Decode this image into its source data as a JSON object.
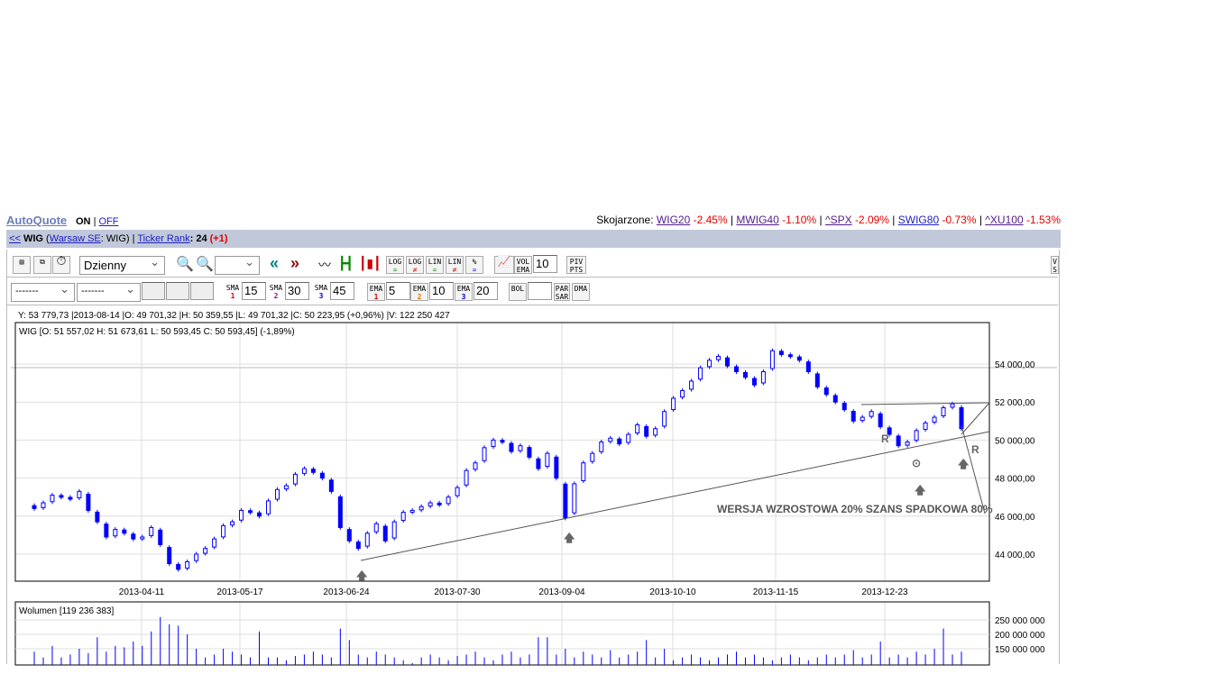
{
  "header": {
    "brand": "AutoQuote",
    "on": "ON",
    "sep": "|",
    "off": "OFF",
    "related_label": "Skojarzone:",
    "related": [
      {
        "name": "WIG20",
        "change": "-2.45%"
      },
      {
        "name": "MWIG40",
        "change": "-1.10%"
      },
      {
        "name": "^SPX",
        "change": "-2.09%"
      },
      {
        "name": "SWIG80",
        "change": "-0.73%"
      },
      {
        "name": "^XU100",
        "change": "-1.53%"
      }
    ]
  },
  "ticker_bar": {
    "back": "<<",
    "symbol": "WIG",
    "paren_open": "(",
    "exchange": "Warsaw SE",
    "exchange_sym": ": WIG)",
    "sep": "|",
    "rank_label": "Ticker Rank",
    "rank_value": ": 24",
    "rank_change": "(+1)"
  },
  "toolbar": {
    "interval": "Dzienny",
    "zoom_select": "",
    "log_eq": [
      "LOG",
      "="
    ],
    "log_ne": [
      "LOG",
      "≠"
    ],
    "lin_eq": [
      "LIN",
      "="
    ],
    "lin_ne": [
      "LIN",
      "≠"
    ],
    "pct": [
      "%",
      "="
    ],
    "vol_ema": [
      "VOL",
      "EMA"
    ],
    "vol_ema_value": "10",
    "piv": [
      "PIV",
      "PTS"
    ],
    "vs": [
      "V",
      "S"
    ]
  },
  "indicators": {
    "select1": "-------",
    "select2": "-------",
    "sma": [
      {
        "label": "SMA",
        "n": "1",
        "value": "15"
      },
      {
        "label": "SMA",
        "n": "2",
        "value": "30"
      },
      {
        "label": "SMA",
        "n": "3",
        "value": "45"
      }
    ],
    "ema": [
      {
        "label": "EMA",
        "n": "1",
        "value": "5"
      },
      {
        "label": "EMA",
        "n": "2",
        "value": "10"
      },
      {
        "label": "EMA",
        "n": "3",
        "value": "20"
      }
    ],
    "bol": "BOL",
    "par": [
      "PAR",
      "SAR"
    ],
    "dma": "DMA"
  },
  "info_line": "Y: 53 779,73 |2013-08-14 |O: 49 701,32 |H: 50 359,55 |L: 49 701,32 |C: 50 223,95 (+0,96%) |V: 122 250 427",
  "colors": {
    "candle": "#0000ff",
    "grid": "#dddddd",
    "trend": "#555555",
    "up": "#008000",
    "down": "#e00000"
  },
  "chart_data": {
    "type": "candlestick",
    "title": "WIG [O: 51 557,02  H: 51 673,61  L: 50 593,45  C: 50 593,45] (-1,89%)",
    "ylim": [
      42580,
      56180
    ],
    "yticks": [
      44000,
      46000,
      48000,
      50000,
      52000,
      54000
    ],
    "ytick_labels": [
      "44 000,00",
      "46 000,00",
      "48 000,00",
      "50 000,00",
      "52 000,00",
      "54 000,00"
    ],
    "xtick_labels": [
      "2013-04-11",
      "2013-05-17",
      "2013-06-24",
      "2013-07-30",
      "2013-09-04",
      "2013-10-10",
      "2013-11-15",
      "2013-12-23"
    ],
    "close": [
      46400,
      46700,
      47100,
      47000,
      46900,
      47300,
      46300,
      45700,
      44900,
      45300,
      45100,
      44800,
      44900,
      45400,
      44500,
      43500,
      43200,
      43600,
      44000,
      44300,
      44800,
      45500,
      45700,
      46300,
      46200,
      46000,
      46800,
      47400,
      47600,
      48200,
      48500,
      48300,
      48000,
      47300,
      45400,
      44700,
      44300,
      45100,
      45600,
      44700,
      45700,
      46200,
      46300,
      46500,
      46700,
      46600,
      47000,
      47500,
      48400,
      48800,
      49600,
      50000,
      49900,
      49400,
      49700,
      49100,
      48500,
      49300,
      48000,
      45900,
      47700,
      48800,
      49300,
      49900,
      50100,
      49800,
      50300,
      50800,
      50200,
      50600,
      51500,
      52200,
      52600,
      53100,
      53800,
      54200,
      54400,
      53900,
      53600,
      53300,
      52900,
      53600,
      54700,
      54500,
      54400,
      54200,
      53600,
      52800,
      52400,
      52000,
      51600,
      51000,
      51200,
      51500,
      50700,
      50300,
      49700,
      49900,
      50500,
      50900,
      51200,
      51700,
      51900,
      50600
    ],
    "volume_label": "Wolumen [119 236 383]",
    "volume_ticks": [
      "250 000 000",
      "200 000 000",
      "150 000 000"
    ],
    "volume": [
      140,
      120,
      160,
      120,
      130,
      150,
      135,
      190,
      140,
      160,
      155,
      175,
      160,
      210,
      260,
      235,
      230,
      200,
      150,
      120,
      130,
      150,
      140,
      130,
      120,
      210,
      120,
      120,
      110,
      125,
      130,
      140,
      130,
      120,
      220,
      180,
      130,
      120,
      140,
      130,
      120,
      110,
      100,
      120,
      130,
      120,
      110,
      125,
      130,
      140,
      120,
      110,
      130,
      140,
      120,
      130,
      190,
      190,
      130,
      150,
      120,
      140,
      130,
      120,
      145,
      120,
      130,
      140,
      180,
      120,
      150,
      110,
      120,
      130,
      120,
      110,
      120,
      130,
      140,
      120,
      130,
      120,
      110,
      120,
      130,
      120,
      110,
      120,
      130,
      120,
      130,
      145,
      120,
      130,
      175,
      120,
      130,
      120,
      140,
      130,
      150,
      220,
      130,
      140
    ],
    "annotations": {
      "note": "WERSJA WZROSTOWA 20% SZANS SPADKOWA 80%",
      "r1": "R",
      "r2": "R"
    }
  }
}
